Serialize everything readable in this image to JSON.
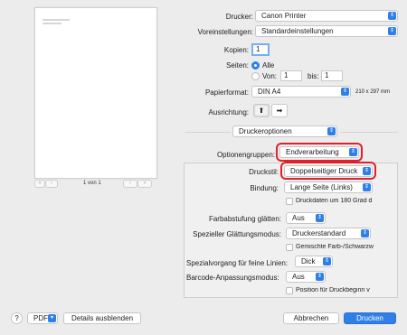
{
  "preview": {
    "page_info": "1 von 1"
  },
  "printer": {
    "label": "Drucker:",
    "value": "Canon Printer"
  },
  "presets": {
    "label": "Voreinstellungen:",
    "value": "Standardeinstellungen"
  },
  "copies": {
    "label": "Kopien:",
    "value": "1"
  },
  "pages": {
    "label": "Seiten:",
    "all_label": "Alle",
    "from_label": "Von:",
    "from_value": "1",
    "to_label": "bis:",
    "to_value": "1"
  },
  "paper": {
    "label": "Papierformat:",
    "value": "DIN A4",
    "size_text": "210 x 297 mm"
  },
  "orientation": {
    "label": "Ausrichtung:"
  },
  "section_menu": {
    "value": "Druckeroptionen"
  },
  "option_groups": {
    "label": "Optionengruppen:",
    "value": "Endverarbeitung"
  },
  "options": {
    "print_style": {
      "label": "Druckstil:",
      "value": "Doppelseitiger Druck"
    },
    "binding": {
      "label": "Bindung:",
      "value": "Lange Seite (Links)"
    },
    "rotate_180": {
      "label": "Druckdaten um 180 Grad d"
    },
    "gradation_smoothing": {
      "label": "Farbabstufung glätten:",
      "value": "Aus"
    },
    "special_smoothing": {
      "label": "Spezieller Glättungsmodus:",
      "value": "Druckerstandard"
    },
    "mixed_color": {
      "label": "Gemischte Farb-/Schwarzw"
    },
    "fine_lines": {
      "label": "Spezialvorgang für feine Linien:",
      "value": "Dick"
    },
    "barcode": {
      "label": "Barcode-Anpassungsmodus:",
      "value": "Aus"
    },
    "start_position": {
      "label": "Position für Druckbeginn v"
    }
  },
  "bottom": {
    "help": "?",
    "pdf": "PDF",
    "details": "Details ausblenden",
    "cancel": "Abbrechen",
    "print": "Drucken"
  },
  "colors": {
    "accent": "#2f7fe6",
    "highlight": "#e0202b"
  }
}
